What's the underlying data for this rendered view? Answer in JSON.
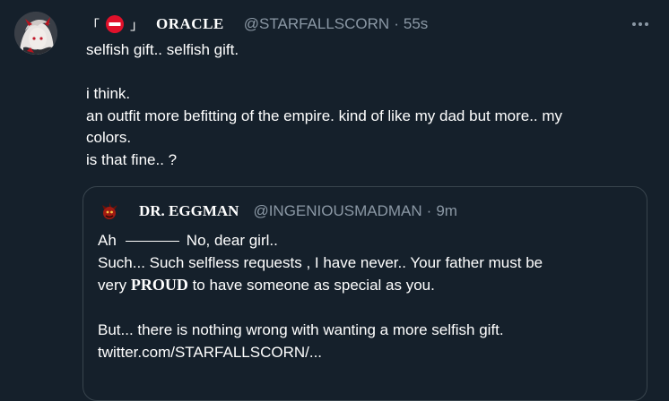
{
  "tweet": {
    "corner_left": "「",
    "corner_right": "」",
    "display_name": "ORACLE",
    "handle": "@STARFALLSCORN",
    "separator": "·",
    "time": "55s",
    "text_lines": [
      "selfish gift.. selfish gift.",
      "",
      "i think.",
      "an outfit more befitting of the empire. kind of like my dad but more.. my",
      "colors.",
      "is that fine.. ?"
    ]
  },
  "quote": {
    "display_name": "DR. EGGMAN",
    "handle": "@INGENIOUSMADMAN",
    "separator": "·",
    "time": "9m",
    "line1_start": "Ah",
    "line1_end": "No, dear girl..",
    "line2": "Such...  Such selfless requests ,  I have never..  Your father must be",
    "line3_start": "very ",
    "line3_bold": "PROUD",
    "line3_end": " to have someone as special as you.",
    "line4": "",
    "line5": "But...  there is nothing wrong with wanting a more selfish gift.",
    "line6": "twitter.com/STARFALLSCORN/..."
  },
  "icons": {
    "more": "more-horizontal-icon",
    "status": "no-entry-icon"
  },
  "colors": {
    "background": "#15202b",
    "secondary_text": "#8b98a5",
    "border": "#38444d",
    "no_entry_red": "#e0112b"
  }
}
